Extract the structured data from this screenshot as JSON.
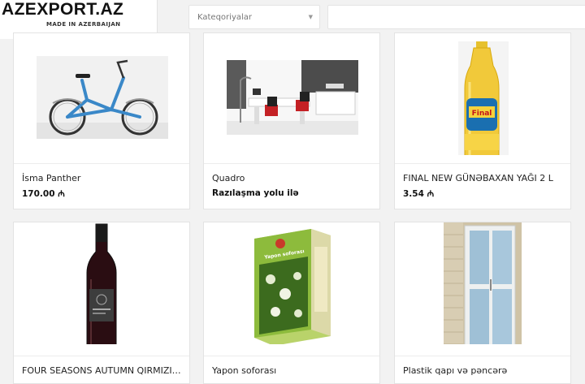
{
  "header": {
    "logo_title": "AZEXPORT.AZ",
    "logo_subtitle": "MADE IN AZERBAIJAN",
    "category_select": "Kateqoriyalar",
    "search_placeholder": ""
  },
  "currency_icon": "manat-icon",
  "products": [
    {
      "name": "İsma Panther",
      "price": "170.00",
      "image": "bicycle-image"
    },
    {
      "name": "Quadro",
      "price": "Razılaşma yolu ilə",
      "image": "office-furniture-image"
    },
    {
      "name": "FINAL NEW GÜNƏBAXAN YAĞI 2 L",
      "price": "3.54",
      "image": "sunflower-oil-bottle-image"
    },
    {
      "name": "FOUR SEASONS AUTUMN QIRMIZI T...",
      "price": "",
      "image": "wine-bottle-image"
    },
    {
      "name": "Yapon soforası",
      "price": "",
      "image": "herbal-tea-box-image",
      "box_label": "Yapon soforası"
    },
    {
      "name": "Plastik qapı və pəncərə",
      "price": "",
      "image": "plastic-door-image"
    }
  ]
}
